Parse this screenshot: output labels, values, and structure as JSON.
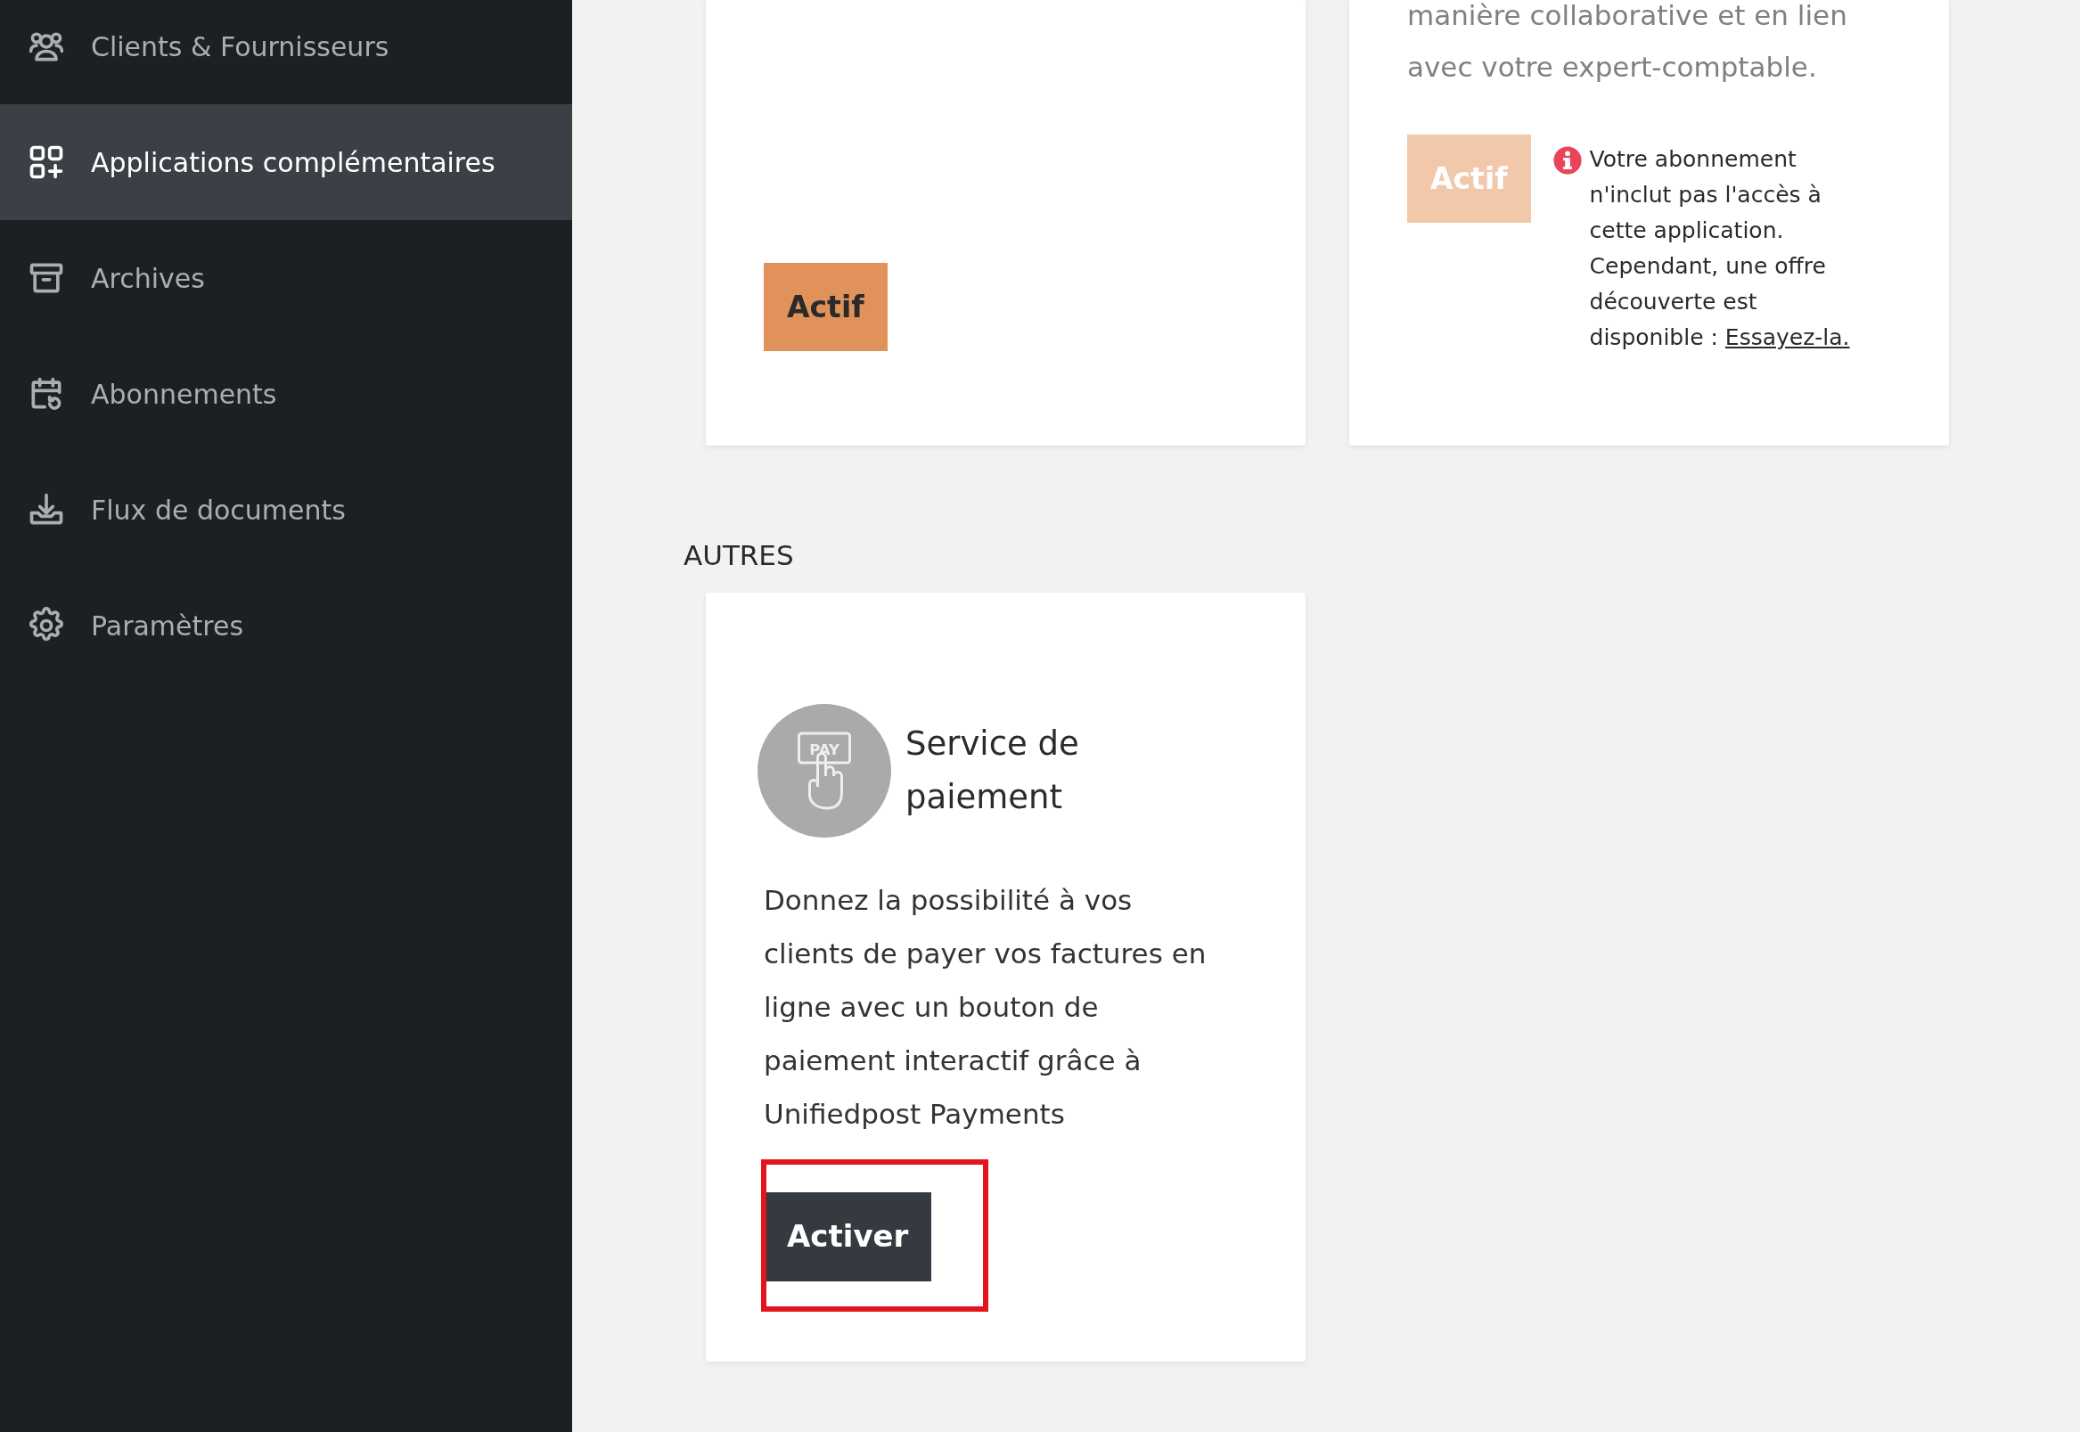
{
  "sidebar": {
    "items": [
      {
        "label": "Clients & Fournisseurs",
        "selected": false
      },
      {
        "label": "Applications complémentaires",
        "selected": true
      },
      {
        "label": "Archives",
        "selected": false
      },
      {
        "label": "Abonnements",
        "selected": false
      },
      {
        "label": "Flux de documents",
        "selected": false
      },
      {
        "label": "Paramètres",
        "selected": false
      }
    ]
  },
  "top_cards": [
    {
      "button": {
        "label": "Actif",
        "disabled": false
      }
    },
    {
      "description": "manière collaborative et en lien avec votre expert-comptable.",
      "button": {
        "label": "Actif",
        "disabled": true
      },
      "notice": {
        "text": "Votre abonnement n'inclut pas l'accès à cette application. Cependant, une offre découverte est disponible :",
        "link": "Essayez-la."
      }
    }
  ],
  "sections": [
    {
      "heading": "AUTRES",
      "cards": [
        {
          "logo_text": "PAY",
          "title": "Service de paiement",
          "description": "Donnez la possibilité à vos clients de payer vos factures en ligne avec un bouton de paiement interactif grâce à Unifiedpost Payments",
          "button": {
            "label": "Activer",
            "highlighted": true
          }
        }
      ]
    }
  ]
}
